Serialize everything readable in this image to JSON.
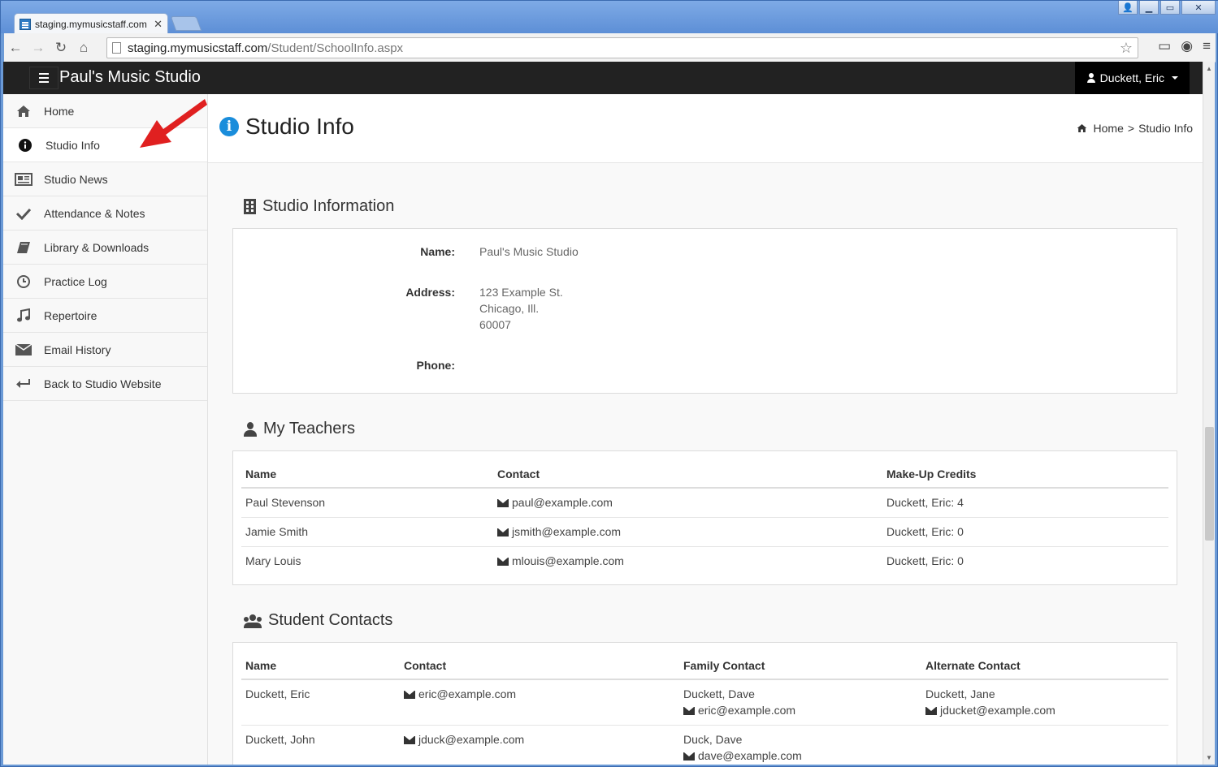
{
  "browser": {
    "tab_title": "staging.mymusicstaff.com",
    "url_host": "staging.mymusicstaff.com",
    "url_path": "/Student/SchoolInfo.aspx"
  },
  "navbar": {
    "brand": "Paul's Music Studio",
    "user": "Duckett, Eric"
  },
  "sidebar": {
    "items": [
      {
        "label": "Home",
        "icon": "home-icon"
      },
      {
        "label": "Studio Info",
        "icon": "info-icon"
      },
      {
        "label": "Studio News",
        "icon": "newspaper-icon"
      },
      {
        "label": "Attendance & Notes",
        "icon": "checkmark-icon"
      },
      {
        "label": "Library & Downloads",
        "icon": "book-icon"
      },
      {
        "label": "Practice Log",
        "icon": "clock-icon"
      },
      {
        "label": "Repertoire",
        "icon": "music-note-icon"
      },
      {
        "label": "Email History",
        "icon": "envelope-icon"
      },
      {
        "label": "Back to Studio Website",
        "icon": "reply-arrow-icon"
      }
    ]
  },
  "header": {
    "title": "Studio Info",
    "breadcrumb_home": "Home",
    "breadcrumb_sep": ">",
    "breadcrumb_current": "Studio Info"
  },
  "studio_info": {
    "heading": "Studio Information",
    "name_label": "Name:",
    "name_value": "Paul's Music Studio",
    "address_label": "Address:",
    "address_line1": "123 Example St.",
    "address_line2": "Chicago, Ill.",
    "address_line3": "60007",
    "phone_label": "Phone:",
    "phone_value": ""
  },
  "teachers": {
    "heading": "My Teachers",
    "columns": [
      "Name",
      "Contact",
      "Make-Up Credits"
    ],
    "rows": [
      {
        "name": "Paul Stevenson",
        "email": "paul@example.com",
        "credits": "Duckett, Eric: 4"
      },
      {
        "name": "Jamie Smith",
        "email": "jsmith@example.com",
        "credits": "Duckett, Eric: 0"
      },
      {
        "name": "Mary Louis",
        "email": "mlouis@example.com",
        "credits": "Duckett, Eric: 0"
      }
    ]
  },
  "contacts": {
    "heading": "Student Contacts",
    "columns": [
      "Name",
      "Contact",
      "Family Contact",
      "Alternate Contact"
    ],
    "rows": [
      {
        "name": "Duckett, Eric",
        "email": "eric@example.com",
        "family_name": "Duckett, Dave",
        "family_email": "eric@example.com",
        "alt_name": "Duckett, Jane",
        "alt_email": "jducket@example.com"
      },
      {
        "name": "Duckett, John",
        "email": "jduck@example.com",
        "family_name": "Duck, Dave",
        "family_email": "dave@example.com",
        "alt_name": "",
        "alt_email": ""
      }
    ]
  },
  "colors": {
    "navbar": "#222222",
    "accent_info": "#1a8ddb",
    "arrow": "#e02020"
  }
}
